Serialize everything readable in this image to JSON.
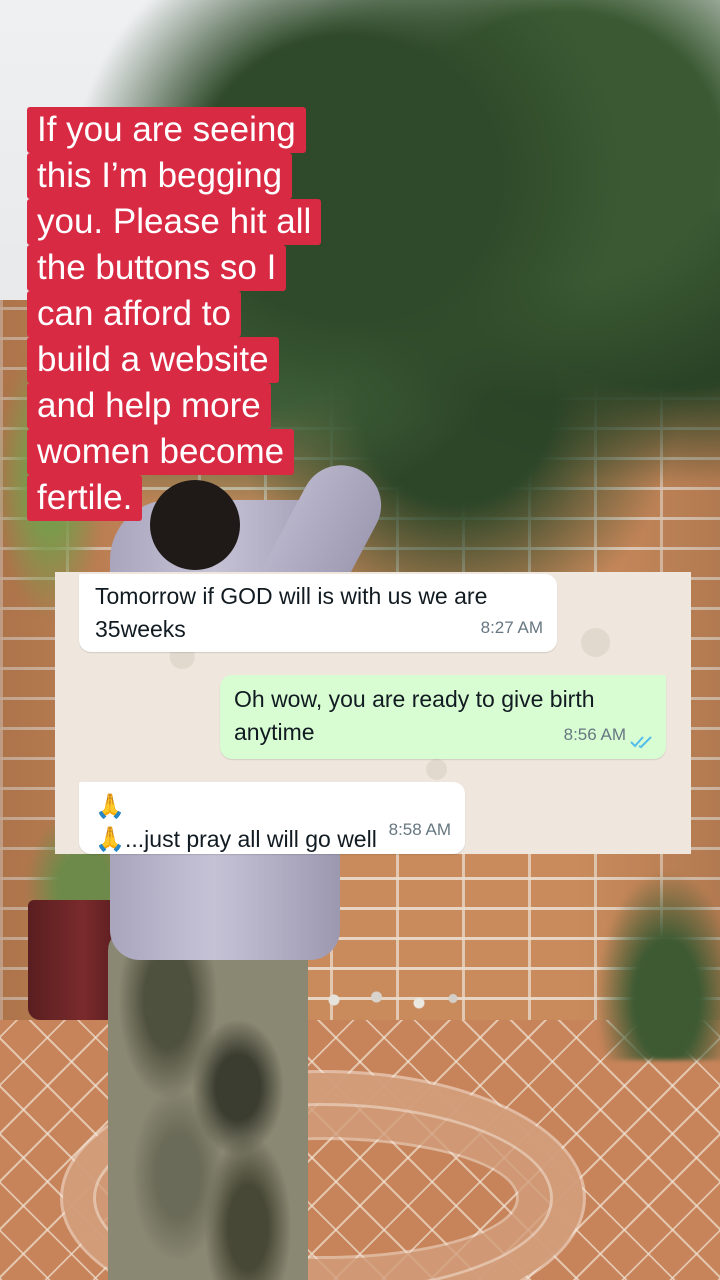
{
  "caption": {
    "lines": [
      "If you are seeing",
      "this I’m begging",
      "you. Please hit all",
      "the buttons so I",
      "can afford to",
      "build a website",
      "and help more",
      "women become",
      "fertile."
    ],
    "background_color": "#d92a44",
    "text_color": "#ffffff"
  },
  "chat": {
    "messages": [
      {
        "direction": "incoming",
        "text_line1": "Tomorrow if GOD will is with us we are",
        "text_line2": "35weeks",
        "time": "8:27 AM"
      },
      {
        "direction": "outgoing",
        "text_line1": "Oh wow, you are ready to give birth",
        "text_line2": "anytime",
        "time": "8:56 AM",
        "status": "read",
        "status_icon": "double-check-icon"
      },
      {
        "direction": "incoming",
        "emoji": "🙏🙏",
        "text": "...just pray all will go well",
        "time": "8:58 AM"
      }
    ],
    "colors": {
      "incoming_bubble": "#ffffff",
      "outgoing_bubble": "#d9fdd3",
      "read_ticks": "#53bdeb",
      "wallpaper": "#efe7dd"
    }
  }
}
